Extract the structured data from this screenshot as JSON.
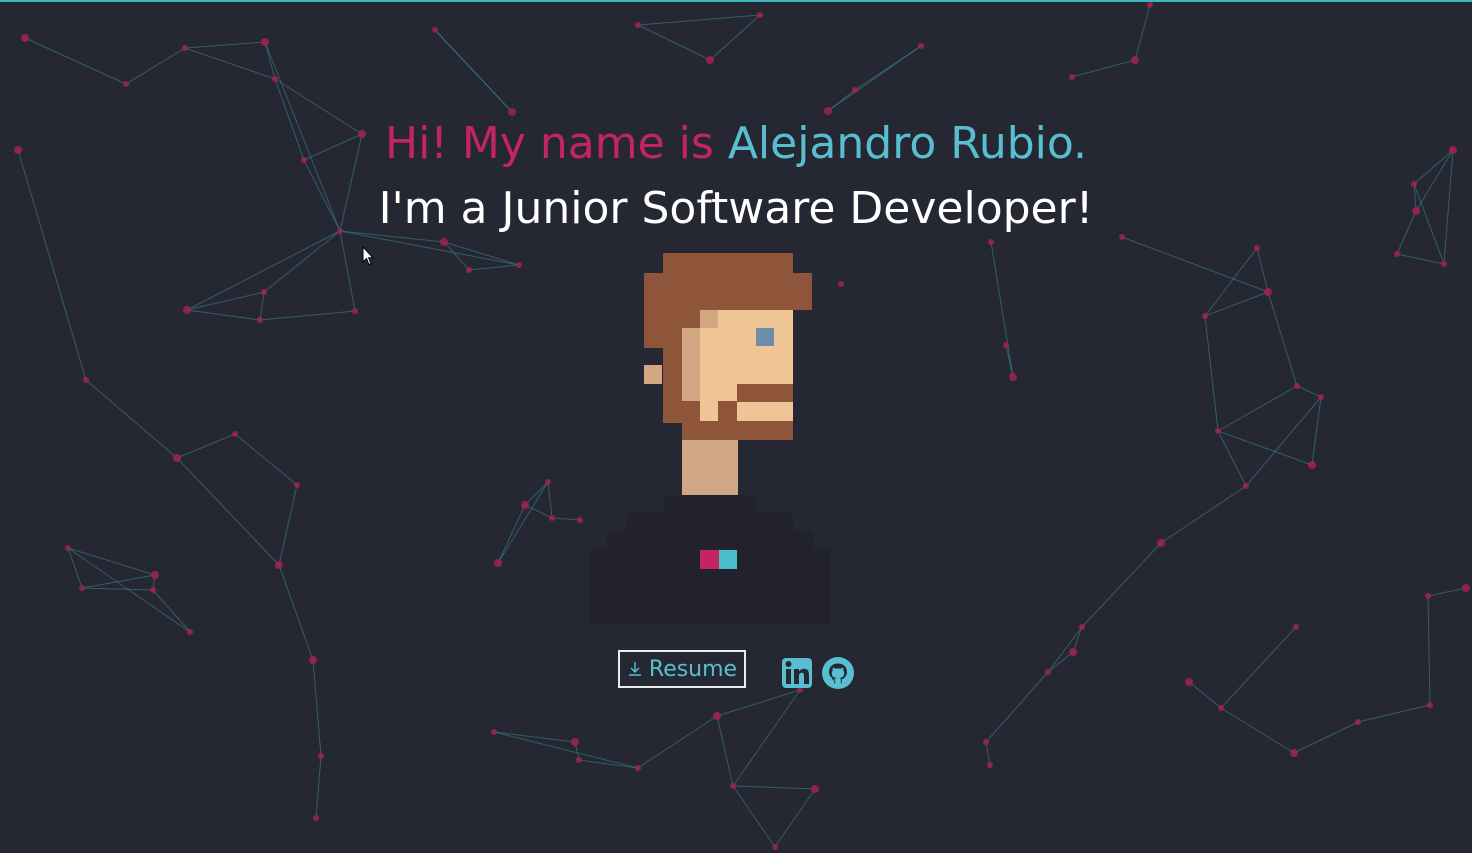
{
  "hero": {
    "greeting": "Hi! My name is ",
    "name": "Alejandro Rubio.",
    "tagline": "I'm a Junior Software Developer!"
  },
  "actions": {
    "resume_label": "Resume",
    "resume_icon": "download-icon",
    "linkedin_icon": "linkedin-icon",
    "github_icon": "github-icon"
  },
  "colors": {
    "background": "#252833",
    "greeting": "#c22464",
    "name": "#59bfd0",
    "tagline": "#ffffff",
    "accent_line": "#3fb6c7",
    "network_node": "#a3224f",
    "network_line": "#3d8a96"
  }
}
